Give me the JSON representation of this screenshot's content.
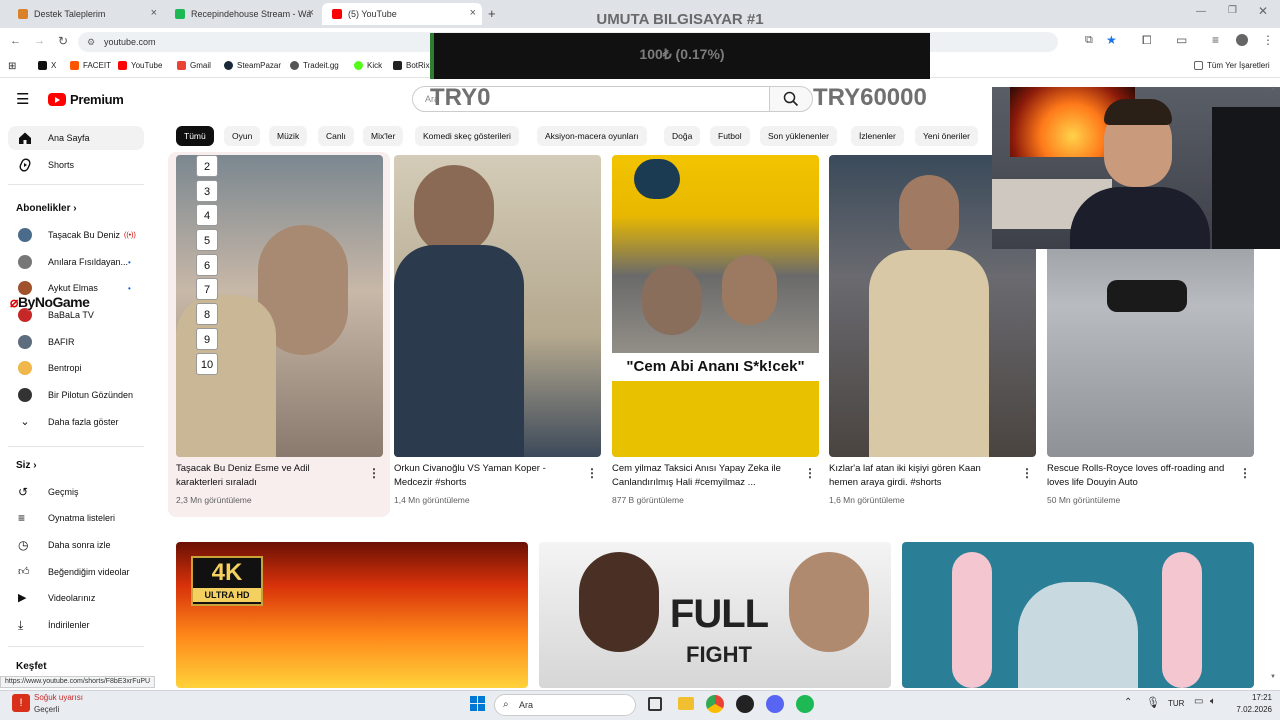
{
  "browser": {
    "tabs": [
      {
        "label": "Destek Taleplerim",
        "color": "#d9822b"
      },
      {
        "label": "Recepindehouse Stream - Watc",
        "color": "#1db954"
      },
      {
        "label": "(5) YouTube",
        "color": "#ff0000"
      }
    ],
    "new_tab": "+",
    "url": "youtube.com",
    "bookmarks": [
      "X",
      "FACEIT",
      "YouTube",
      "Gmail",
      "SteamPazar",
      "Tradeit.gg",
      "Kick",
      "BotRix"
    ],
    "all_bookmarks": "Tüm Yer İşaretleri",
    "status_url": "https://www.youtube.com/shorts/F8bE3xrFuPU"
  },
  "stream_overlay": {
    "title": "UMUTA BILGISAYAR #1",
    "progress_text": "100₺ (0.17%)",
    "progress_fraction": 0.0017,
    "goal_start": "TRY0",
    "goal_end": "TRY60000",
    "channel_tag": "ByNoGame"
  },
  "youtube": {
    "logo": "Premium",
    "search_placeholder": "Ara",
    "sidebar": {
      "home": "Ana Sayfa",
      "shorts": "Shorts",
      "subs_title": "Abonelikler",
      "subs": [
        "Taşacak Bu Deniz",
        "Anılara Fısıldayan...",
        "Aykut Elmas",
        "BaBaLa TV",
        "BAFIR",
        "Bentropi",
        "Bir Pilotun Gözünden"
      ],
      "show_more": "Daha fazla göster",
      "you_title": "Siz",
      "you_items": [
        "Geçmiş",
        "Oynatma listeleri",
        "Daha sonra izle",
        "Beğendiğim videolar",
        "Videolarınız",
        "İndirilenler"
      ],
      "explore_title": "Keşfet"
    },
    "chips": [
      "Tümü",
      "Oyun",
      "Müzik",
      "Canlı",
      "Mix'ler",
      "Komedi skeç gösterileri",
      "Aksiyon-macera oyunları",
      "Doğa",
      "Futbol",
      "Son yüklenenler",
      "İzlenenler",
      "Yeni öneriler"
    ],
    "shorts": [
      {
        "title": "Taşacak Bu Deniz Esme ve Adil karakterleri sıraladı",
        "views": "2,3 Mn görüntüleme",
        "numbers": [
          "2",
          "3",
          "4",
          "5",
          "6",
          "7",
          "8",
          "9",
          "10"
        ]
      },
      {
        "title": "Orkun Civanoğlu VS Yaman Koper - Medcezir #shorts",
        "views": "1,4 Mn görüntüleme"
      },
      {
        "title": "Cem yilmaz Taksici Anısı Yapay Zeka ile Canlandırılmış Hali #cemyilmaz ...",
        "views": "877 B görüntüleme",
        "caption": "\"Cem Abi Ananı S*k!cek\""
      },
      {
        "title": "Kızlar'a laf atan iki kişiyi gören Kaan hemen araya girdi. #shorts",
        "views": "1,6 Mn görüntüleme"
      },
      {
        "title": "Rescue Rolls-Royce loves off-roading and loves life Douyin Auto",
        "views": "50 Mn görüntüleme"
      }
    ],
    "videos": [
      {
        "badge_top": "4K",
        "badge_bottom": "ULTRA HD"
      },
      {
        "text_top": "FULL",
        "text_bottom": "FIGHT"
      },
      {}
    ]
  },
  "taskbar": {
    "search": "Ara",
    "weather_title": "Soğuk uyarısı",
    "weather_sub": "Geçerli",
    "lang": "TUR",
    "time": "17:21",
    "date": "7.02.2026"
  }
}
